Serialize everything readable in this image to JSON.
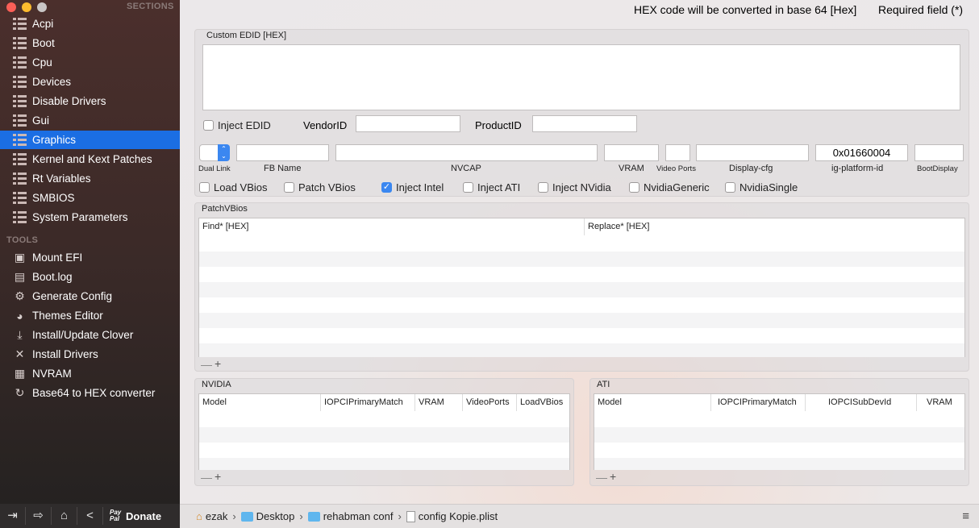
{
  "window": {
    "sections_header": "SECTIONS",
    "tools_header": "TOOLS"
  },
  "sidebar": {
    "sections": [
      {
        "label": "Acpi"
      },
      {
        "label": "Boot"
      },
      {
        "label": "Cpu"
      },
      {
        "label": "Devices"
      },
      {
        "label": "Disable Drivers"
      },
      {
        "label": "Gui"
      },
      {
        "label": "Graphics",
        "active": true
      },
      {
        "label": "Kernel and Kext Patches"
      },
      {
        "label": "Rt Variables"
      },
      {
        "label": "SMBIOS"
      },
      {
        "label": "System Parameters"
      }
    ],
    "tools": [
      {
        "label": "Mount EFI",
        "icon": "disk-icon"
      },
      {
        "label": "Boot.log",
        "icon": "log-icon"
      },
      {
        "label": "Generate Config",
        "icon": "gear-icon"
      },
      {
        "label": "Themes Editor",
        "icon": "palette-icon"
      },
      {
        "label": "Install/Update Clover",
        "icon": "download-icon"
      },
      {
        "label": "Install Drivers",
        "icon": "tools-icon"
      },
      {
        "label": "NVRAM",
        "icon": "chip-icon"
      },
      {
        "label": "Base64 to HEX converter",
        "icon": "convert-icon"
      }
    ]
  },
  "header": {
    "hex_note": "HEX code will be converted in base 64 [Hex]",
    "required_note": "Required field (*)"
  },
  "edid": {
    "title": "Custom EDID [HEX]",
    "value": "",
    "inject_label": "Inject EDID",
    "inject_checked": false,
    "vendor_label": "VendorID",
    "vendor_value": "",
    "product_label": "ProductID",
    "product_value": ""
  },
  "graphics": {
    "dual_link_label": "Dual Link",
    "fb_name_label": "FB Name",
    "fb_name": "",
    "nvcap_label": "NVCAP",
    "nvcap": "",
    "vram_label": "VRAM",
    "vram": "",
    "video_ports_label": "Video Ports",
    "video_ports": "",
    "display_cfg_label": "Display-cfg",
    "display_cfg": "",
    "ig_platform_label": "ig-platform-id",
    "ig_platform": "0x01660004",
    "boot_display_label": "BootDisplay",
    "boot_display": "",
    "checkboxes": [
      {
        "label": "Load VBios",
        "checked": false
      },
      {
        "label": "Patch VBios",
        "checked": false
      },
      {
        "label": "Inject Intel",
        "checked": true
      },
      {
        "label": "Inject ATI",
        "checked": false
      },
      {
        "label": "Inject NVidia",
        "checked": false
      },
      {
        "label": "NvidiaGeneric",
        "checked": false
      },
      {
        "label": "NvidiaSingle",
        "checked": false
      }
    ]
  },
  "patchvbios": {
    "title": "PatchVBios",
    "columns": [
      "Find* [HEX]",
      "Replace* [HEX]"
    ]
  },
  "nvidia": {
    "title": "NVIDIA",
    "columns": [
      "Model",
      "IOPCIPrimaryMatch",
      "VRAM",
      "VideoPorts",
      "LoadVBios"
    ]
  },
  "ati": {
    "title": "ATI",
    "columns": [
      "Model",
      "IOPCIPrimaryMatch",
      "IOPCISubDevId",
      "VRAM"
    ]
  },
  "controls": {
    "minus": "—",
    "plus": "+"
  },
  "bottom": {
    "donate_paypal": "Pay Pal",
    "donate": "Donate",
    "path": [
      "ezak",
      "Desktop",
      "rehabman conf",
      "config Kopie.plist"
    ]
  }
}
